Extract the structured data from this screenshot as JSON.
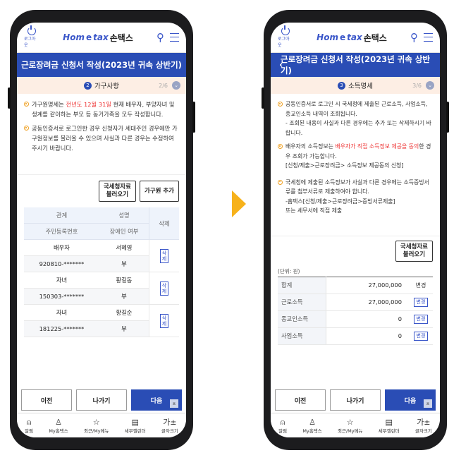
{
  "colors": {
    "brand_blue": "#2a4db5",
    "accent_orange": "#f7b21b",
    "highlight_red": "#e33333",
    "step_bg": "#fdeee4"
  },
  "topbar": {
    "logout_label": "로그아웃",
    "logo_home": "Hom",
    "logo_tax": "tax",
    "logo_e": "e",
    "logo_son": "손택스",
    "search_icon": "search-icon",
    "menu_icon": "menu-icon"
  },
  "screen1": {
    "title": "근로장려금 신청서 작성(2023년 귀속 상반기)",
    "step": {
      "num": "2",
      "label": "가구사항",
      "count": "2/6"
    },
    "notices": [
      {
        "pre": "가구원명세는 ",
        "red": "전년도 12월 31일",
        "post": " 현재 배우자, 부양자녀 및 생계를 같이하는 부모 등 동거가족을 모두 작성합니다."
      },
      {
        "text": "공동인증서로 로그인한 경우 신청자가 세대주인 경우에만 가구원정보를 불러올 수 있으며 사실과 다른 경우는 수정하여 주시기 바랍니다."
      }
    ],
    "buttons": {
      "import_line1": "국세청자료",
      "import_line2": "불러오기",
      "add_member": "가구원 추가"
    },
    "table": {
      "headers": {
        "relation": "관계",
        "name": "성명",
        "rrn": "주민등록번호",
        "disabled": "장애인 여부",
        "delete": "삭제"
      },
      "rows": [
        {
          "relation": "배우자",
          "name": "서혜영",
          "rrn": "920810-*******",
          "disabled": "부",
          "del1": "삭",
          "del2": "제"
        },
        {
          "relation": "자녀",
          "name": "황길동",
          "rrn": "150303-*******",
          "disabled": "부",
          "del1": "삭",
          "del2": "제"
        },
        {
          "relation": "자녀",
          "name": "황길순",
          "rrn": "181225-*******",
          "disabled": "부",
          "del1": "삭",
          "del2": "제"
        }
      ]
    },
    "nav": {
      "prev": "이전",
      "exit": "나가기",
      "next": "다음"
    }
  },
  "screen2": {
    "title": "근로장려금 신청서 작성(2023년 귀속 상반기)",
    "step": {
      "num": "3",
      "label": "소득명세",
      "count": "3/6"
    },
    "notices": [
      {
        "text": "공동인증서로 로그인 시 국세청에 제출된 근로소득, 사업소득, 종교인소득 내역이 조회됩니다.",
        "sub": "- 조회된 내용이 사실과 다른 경우에는 추가 또는 삭제하시기 바랍니다."
      },
      {
        "pre": "배우자의 소득정보는 ",
        "red": "배우자가 직접 소득정보 제공을 동의",
        "post": "한 경우 조회가 가능합니다.",
        "sub": "[신청/제출>근로장려금> 소득정보 제공동의 신청]"
      },
      {
        "text": "국세청에 제출된 소득정보가 사실과 다른 경우에는 소득증빙서류를 첨부서류로 제출하여야 합니다.",
        "sub": "-홈택스[신청/제출>근로장려금>증빙서류제출]",
        "sub2": "또는 세무서에 직접 제출"
      }
    ],
    "buttons": {
      "import_line1": "국세청자료",
      "import_line2": "불러오기"
    },
    "unit": "(단위: 원)",
    "income": [
      {
        "label": "합계",
        "value": "27,000,000",
        "action": "변경",
        "boxed": false
      },
      {
        "label": "근로소득",
        "value": "27,000,000",
        "action": "변경",
        "boxed": true
      },
      {
        "label": "종교인소득",
        "value": "0",
        "action": "변경",
        "boxed": true
      },
      {
        "label": "사업소득",
        "value": "0",
        "action": "변경",
        "boxed": true
      }
    ],
    "nav": {
      "prev": "이전",
      "exit": "나가기",
      "next": "다음"
    }
  },
  "bottomnav": [
    {
      "icon": "bell-icon",
      "glyph": "⍝",
      "label": "알림"
    },
    {
      "icon": "person-icon",
      "glyph": "♙",
      "label": "My홈택스"
    },
    {
      "icon": "star-icon",
      "glyph": "☆",
      "label": "최근/My메뉴"
    },
    {
      "icon": "calendar-icon",
      "glyph": "▤",
      "label": "세무캘린더"
    },
    {
      "icon": "fontsize-icon",
      "glyph": "가±",
      "label": "글자크기"
    }
  ],
  "scrolltop_glyph": "⌅"
}
